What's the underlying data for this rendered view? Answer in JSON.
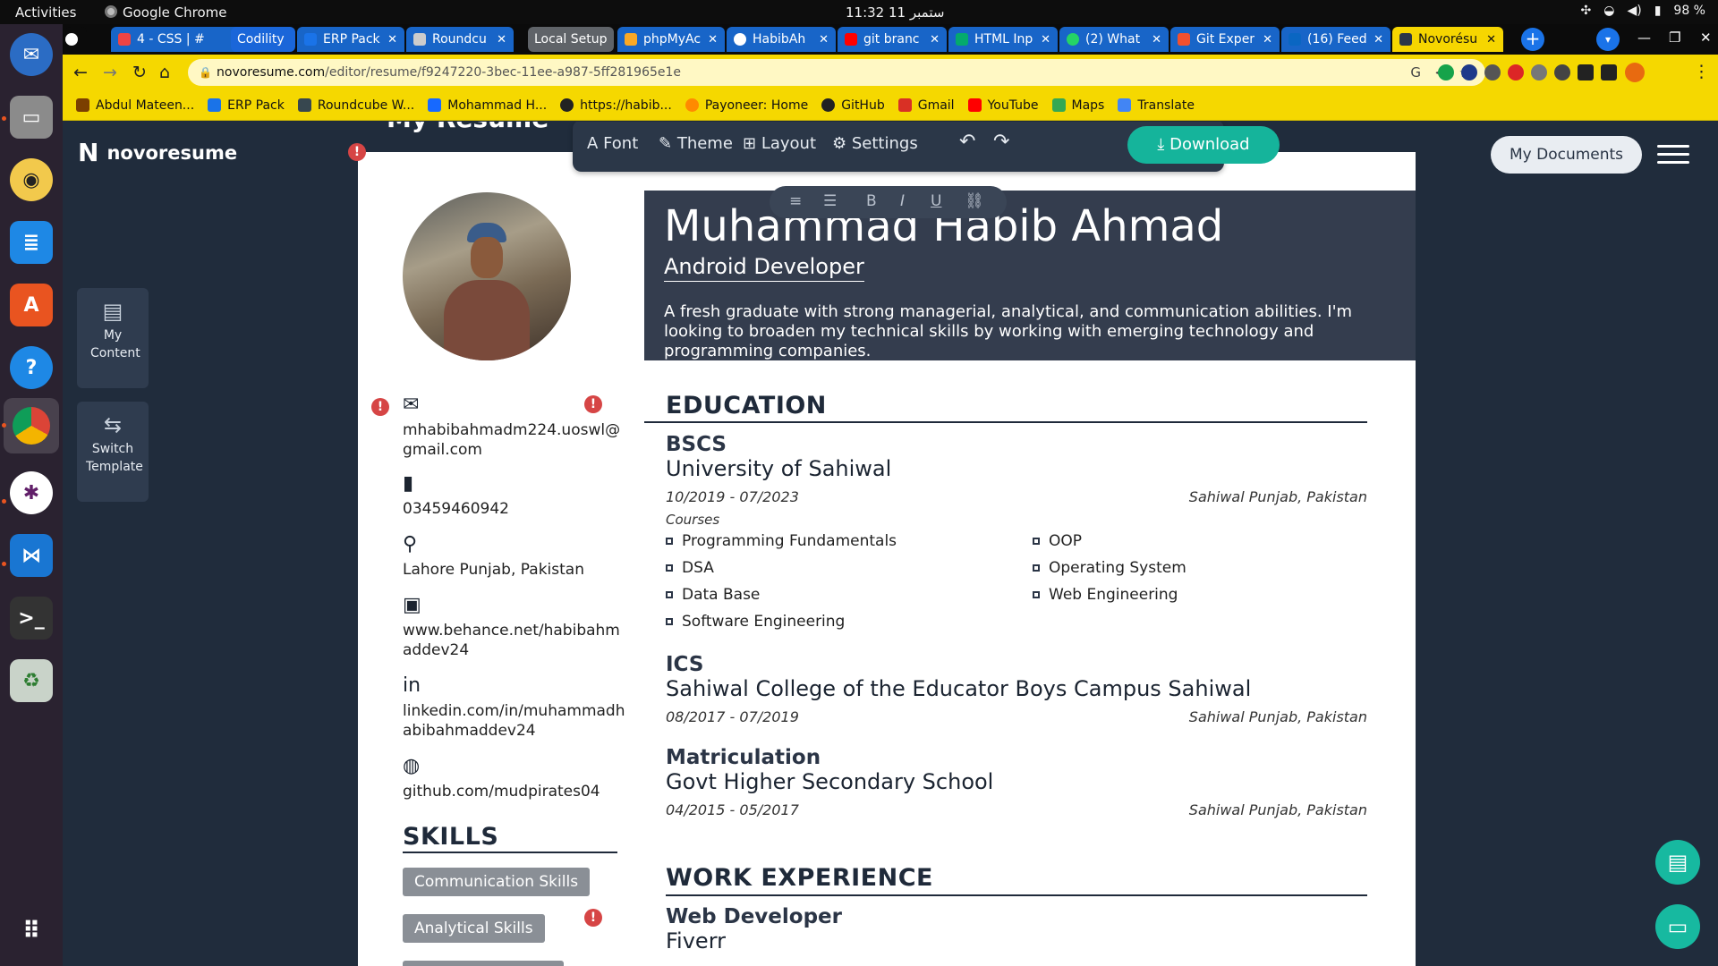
{
  "system": {
    "activities": "Activities",
    "app_name": "Google Chrome",
    "clock": "11:32  11 ستمبر",
    "battery": "98 %"
  },
  "tabs": [
    {
      "title": "4 - CSS | #",
      "kind": "normal"
    },
    {
      "title": "Codility",
      "kind": "group"
    },
    {
      "title": "ERP Pack",
      "kind": "normal"
    },
    {
      "title": "Roundcu",
      "kind": "normal"
    },
    {
      "title": "Local Setup",
      "kind": "group2"
    },
    {
      "title": "phpMyAc",
      "kind": "normal"
    },
    {
      "title": "HabibAh",
      "kind": "normal"
    },
    {
      "title": "git branc",
      "kind": "normal"
    },
    {
      "title": "HTML Inp",
      "kind": "normal"
    },
    {
      "title": "(2) What",
      "kind": "normal"
    },
    {
      "title": "Git Exper",
      "kind": "normal"
    },
    {
      "title": "(16) Feed",
      "kind": "normal"
    },
    {
      "title": "Novorésu",
      "kind": "active"
    }
  ],
  "address": {
    "domain": "novoresume.com",
    "path": "/editor/resume/f9247220-3bec-11ee-a987-5ff281965e1e"
  },
  "bookmarks": [
    {
      "label": "Abdul Mateen...",
      "color": "#7b3f00"
    },
    {
      "label": "ERP Pack",
      "color": "#1a73e8"
    },
    {
      "label": "Roundcube W...",
      "color": "#37474f"
    },
    {
      "label": "Mohammad H...",
      "color": "#1769ff"
    },
    {
      "label": "https://habib...",
      "color": "#222222"
    },
    {
      "label": "Payoneer: Home",
      "color": "#ff8a00"
    },
    {
      "label": "GitHub",
      "color": "#222222"
    },
    {
      "label": "Gmail",
      "color": "#d93025"
    },
    {
      "label": "YouTube",
      "color": "#ff0000"
    },
    {
      "label": "Maps",
      "color": "#34a853"
    },
    {
      "label": "Translate",
      "color": "#4285f4"
    }
  ],
  "app": {
    "logo": "novoresume",
    "page_title": "My Resume",
    "my_content": "My Content",
    "switch_template": "Switch Template",
    "my_documents": "My Documents"
  },
  "toolbar": {
    "font": "Font",
    "theme": "Theme",
    "layout": "Layout",
    "settings": "Settings",
    "download": "Download"
  },
  "resume": {
    "name": "Muhammad Habib Ahmad",
    "role": "Android Developer",
    "summary": "A fresh graduate with strong managerial, analytical, and communication abilities. I'm looking to broaden my technical skills by working with emerging technology and programming companies.",
    "contacts": {
      "email": "mhabibahmadm224.uoswl@gmail.com",
      "phone": "03459460942",
      "location": "Lahore Punjab, Pakistan",
      "behance": "www.behance.net/habibahmaddev24",
      "linkedin": "linkedin.com/in/muhammadhabibahmaddev24",
      "github": "github.com/mudpirates04"
    },
    "skills_title": "SKILLS",
    "skills": [
      "Communication Skills",
      "Analytical Skills"
    ],
    "education_title": "EDUCATION",
    "education": [
      {
        "degree": "BSCS",
        "institution": "University of Sahiwal",
        "dates": "10/2019 - 07/2023",
        "location": "Sahiwal Punjab, Pakistan"
      },
      {
        "degree": "ICS",
        "institution": "Sahiwal College of the Educator Boys Campus Sahiwal",
        "dates": "08/2017 - 07/2019",
        "location": "Sahiwal Punjab, Pakistan"
      },
      {
        "degree": "Matriculation",
        "institution": "Govt Higher Secondary School",
        "dates": "04/2015 - 05/2017",
        "location": "Sahiwal Punjab, Pakistan"
      }
    ],
    "courses_label": "Courses",
    "courses_left": [
      "Programming Fundamentals",
      "DSA",
      "Data Base",
      "Software Engineering"
    ],
    "courses_right": [
      "OOP",
      "Operating System",
      "Web Engineering"
    ],
    "work_title": "WORK EXPERIENCE",
    "work": [
      {
        "title": "Web Developer",
        "company": "Fiverr"
      }
    ]
  },
  "colors": {
    "accent": "#15b49b",
    "header": "#343d4e",
    "chrome": "#f5d800",
    "error": "#d64545"
  }
}
